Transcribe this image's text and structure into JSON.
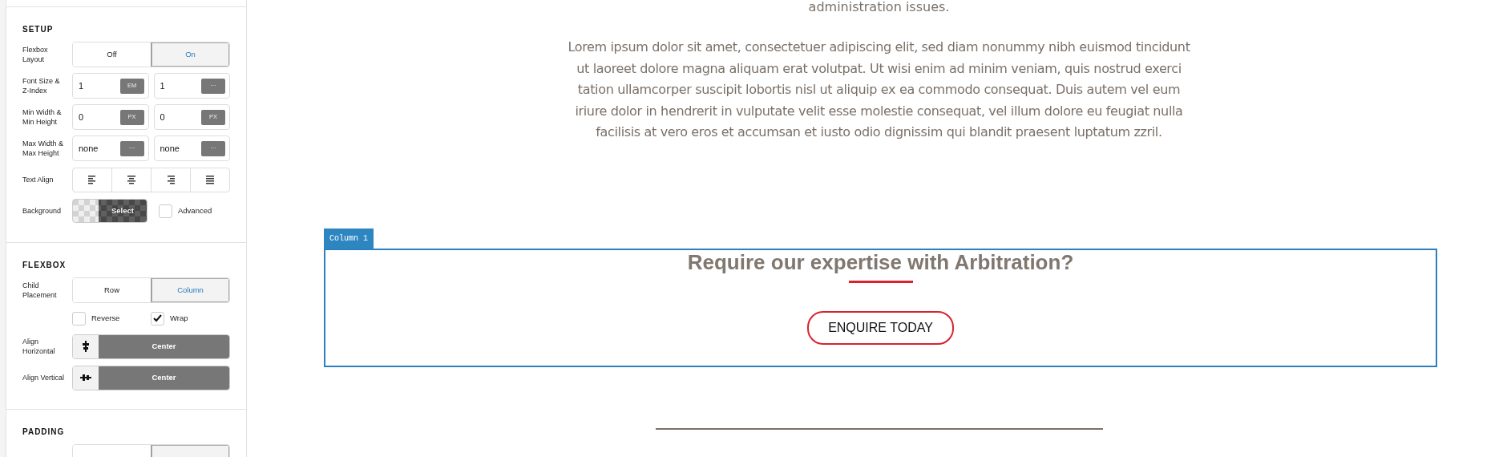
{
  "sidebar": {
    "sections": [
      {
        "title": "SETUP",
        "rows": [
          {
            "kind": "toggle",
            "label": "Flexbox Layout",
            "options": [
              {
                "label": "Off",
                "selected": false
              },
              {
                "label": "On",
                "selected": true
              }
            ]
          },
          {
            "kind": "inputs",
            "label": "Font Size & Z-Index",
            "fields": [
              {
                "value": "1",
                "unit": "EM"
              },
              {
                "value": "1",
                "unit": "···"
              }
            ]
          },
          {
            "kind": "inputs",
            "label": "Min Width & Min Height",
            "fields": [
              {
                "value": "0",
                "unit": "PX"
              },
              {
                "value": "0",
                "unit": "PX"
              }
            ]
          },
          {
            "kind": "inputs",
            "label": "Max Width & Max Height",
            "fields": [
              {
                "value": "none",
                "unit": "···"
              },
              {
                "value": "none",
                "unit": "···"
              }
            ]
          },
          {
            "kind": "align",
            "label": "Text Align"
          },
          {
            "kind": "background",
            "label": "Background",
            "button": "Select",
            "checkbox": {
              "label": "Advanced",
              "checked": false
            }
          }
        ]
      },
      {
        "title": "FLEXBOX",
        "rows": [
          {
            "kind": "toggle",
            "label": "Child Placement",
            "options": [
              {
                "label": "Row",
                "selected": false
              },
              {
                "label": "Column",
                "selected": true
              }
            ]
          },
          {
            "kind": "checks",
            "items": [
              {
                "label": "Reverse",
                "checked": false
              },
              {
                "label": "Wrap",
                "checked": true
              }
            ]
          },
          {
            "kind": "select",
            "label": "Align Horizontal",
            "value": "Center"
          },
          {
            "kind": "select",
            "label": "Align Vertical",
            "value": "Center"
          }
        ]
      },
      {
        "title": "PADDING",
        "rows": [
          {
            "kind": "stub"
          }
        ]
      }
    ]
  },
  "content": {
    "intro_tail": "administration issues.",
    "paragraph_lines": [
      "Lorem ipsum dolor sit amet, consectetuer adipiscing elit, sed diam nonummy nibh euismod tincidunt",
      "ut laoreet dolore magna aliquam erat volutpat. Ut wisi enim ad minim veniam, quis nostrud exerci",
      "tation ullamcorper suscipit lobortis nisl ut aliquip ex ea commodo consequat. Duis autem vel eum",
      "iriure dolor in hendrerit in vulputate velit esse molestie consequat, vel illum dolore eu feugiat nulla",
      "facilisis at vero eros et accumsan et iusto odio dignissim qui blandit praesent luptatum zzril."
    ],
    "column": {
      "tag": "Column 1",
      "heading": "Require our expertise with Arbitration?",
      "button": "ENQUIRE TODAY"
    }
  }
}
